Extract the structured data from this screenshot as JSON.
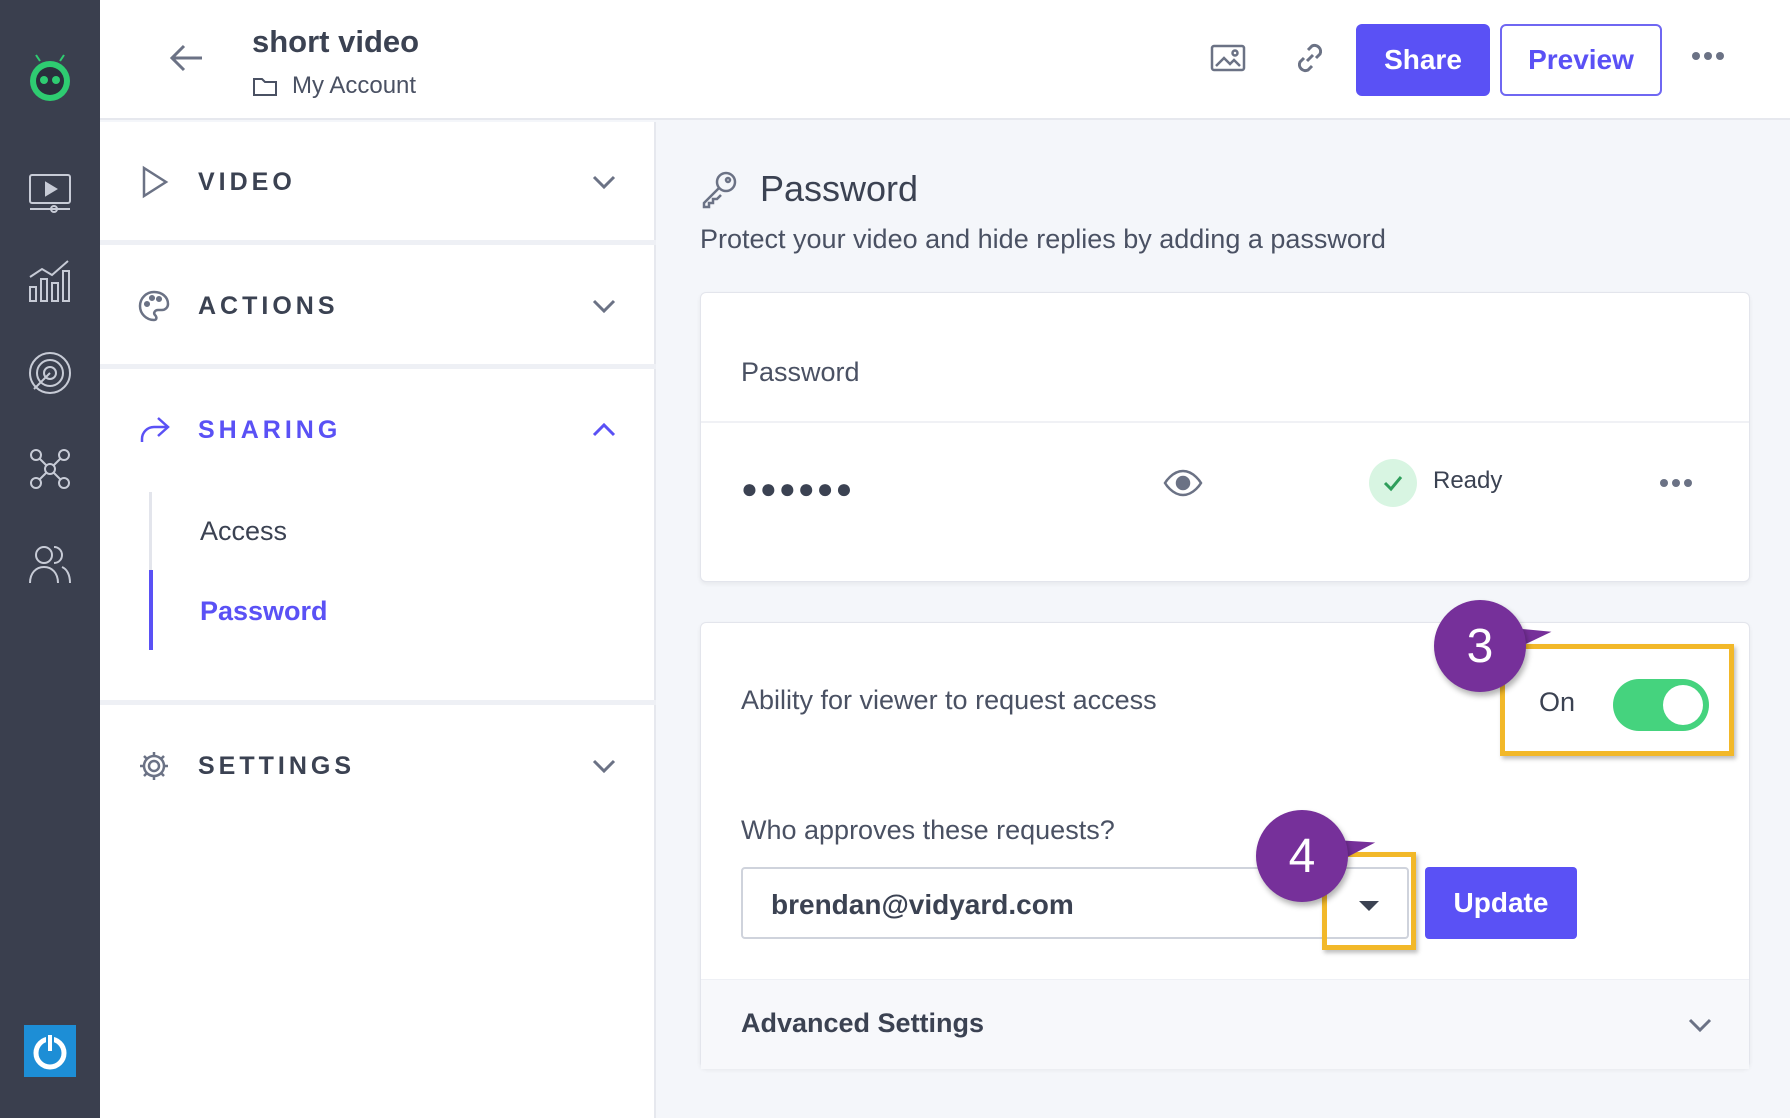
{
  "rail": {
    "icons": [
      "vidyard-logo-icon",
      "video-library-icon",
      "analytics-icon",
      "target-icon",
      "integrations-icon",
      "users-icon",
      "power-icon"
    ]
  },
  "header": {
    "title": "short video",
    "breadcrumb": "My Account",
    "share_label": "Share",
    "preview_label": "Preview"
  },
  "sidebar": {
    "sections": [
      {
        "label": "VIDEO",
        "icon": "play-icon",
        "expanded": false
      },
      {
        "label": "ACTIONS",
        "icon": "palette-icon",
        "expanded": false
      },
      {
        "label": "SHARING",
        "icon": "share-arrow-icon",
        "expanded": true
      },
      {
        "label": "SETTINGS",
        "icon": "gear-icon",
        "expanded": false
      }
    ],
    "sharing_items": [
      {
        "label": "Access",
        "active": false
      },
      {
        "label": "Password",
        "active": true
      }
    ]
  },
  "main": {
    "title": "Password",
    "subtitle": "Protect your video and hide replies by adding a password",
    "password_card": {
      "heading": "Password",
      "masked_value": "●●●●●●",
      "status": "Ready"
    },
    "access_card": {
      "request_label": "Ability for viewer to request access",
      "toggle_text": "On",
      "toggle_on": true,
      "approver_question": "Who approves these requests?",
      "approver_value": "brendan@vidyard.com",
      "update_label": "Update",
      "advanced_label": "Advanced Settings"
    }
  },
  "annotations": [
    {
      "number": "3"
    },
    {
      "number": "4"
    }
  ],
  "colors": {
    "accent": "#5a51f5",
    "rail": "#3a3f4e",
    "toggle_on": "#45d37e",
    "highlight": "#f2b829",
    "callout": "#76309a"
  }
}
